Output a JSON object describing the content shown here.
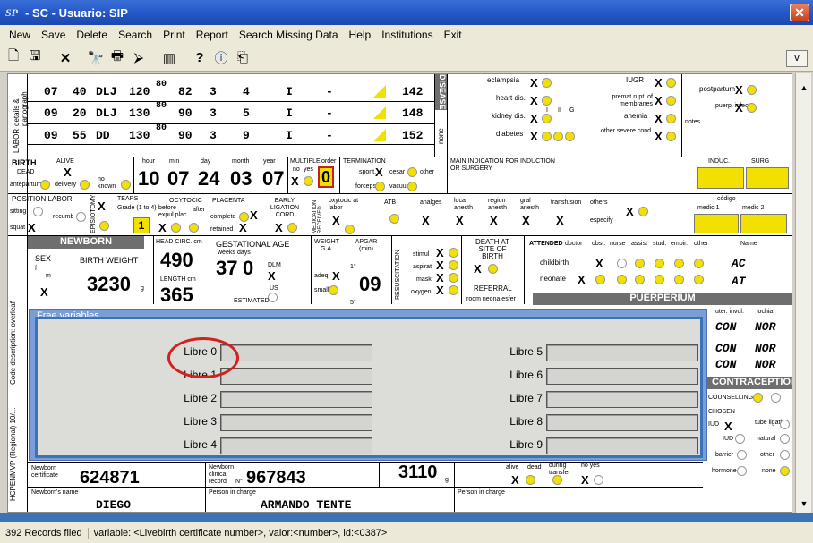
{
  "window": {
    "icon": "SP",
    "title": "- SC - Usuario: SIP",
    "close": "✕"
  },
  "menu": [
    "New",
    "Save",
    "Delete",
    "Search",
    "Print",
    "Report",
    "Search Missing Data",
    "Help",
    "Institutions",
    "Exit"
  ],
  "toolbar": {
    "v_label": "v"
  },
  "labor": {
    "side_labels": [
      "details & partograph",
      "LABOR"
    ],
    "rows": [
      [
        "07",
        "40",
        "DLJ",
        "120",
        "80",
        "82",
        "3",
        "4",
        "I",
        "-",
        "142"
      ],
      [
        "09",
        "20",
        "DLJ",
        "130",
        "80",
        "90",
        "3",
        "5",
        "I",
        "-",
        "148"
      ],
      [
        "09",
        "55",
        "DD",
        "130",
        "80",
        "90",
        "3",
        "9",
        "I",
        "-",
        "152"
      ]
    ]
  },
  "diseases": {
    "header": "DISEASES",
    "none": "none",
    "items_left": [
      "eclampsia",
      "heart dis.",
      "kidney dis.",
      "diabetes"
    ],
    "items_right": [
      "IUGR",
      "premat rupt. of membranes",
      "anemia",
      "other severe cond."
    ],
    "items_far": [
      "postpartum",
      "puerp. infect",
      "notes"
    ],
    "diabetes_types": [
      "I",
      "II",
      "G"
    ]
  },
  "birth": {
    "title": "BIRTH",
    "alive": "ALIVE",
    "dead": "DEAD",
    "antepartum": "antepartum",
    "delivery": "delivery",
    "no_known": "no known",
    "hour_label": "hour",
    "min_label": "min",
    "day_label": "day",
    "month_label": "month",
    "year_label": "year",
    "hour": "10",
    "min": "07",
    "day": "24",
    "month": "03",
    "year": "07",
    "multiple": "MULTIPLE",
    "order": "order",
    "order_value": "0",
    "no": "no",
    "yes": "yes",
    "termination": "TERMINATION",
    "spont": "spont.",
    "cesar": "cesar",
    "forceps": "forceps",
    "vacuum": "vacuum",
    "other": "other",
    "main_indication": "MAIN INDICATION FOR INDUCTION OR SURGERY",
    "induc": "INDUC.",
    "surg": "SURG",
    "code": "code"
  },
  "position": {
    "title": "POSITION LABOR",
    "sitting": "sitting",
    "recumb": "recumb",
    "squat": "squat",
    "episiotomy": "EPISIOTOMY",
    "tears": "TEARS",
    "grade": "Grade (1 to 4)",
    "tears_value": "1",
    "oxytocic": "OCYTOCIC",
    "before_expul": "before expul plac",
    "after": "after",
    "placenta": "PLACENTA",
    "complete": "complete",
    "retained": "retained",
    "early_ligation": "EARLY LIGATION CORD",
    "medication": "MEDICATION RECEIVED",
    "oxytocic_labor": "oxytocic at labor",
    "atb": "ATB",
    "analges": "analges",
    "local_anesth": "local anesth",
    "region_anesth": "region anesth",
    "gral_anesth": "gral anesth",
    "transfusion": "transfusion",
    "others": "others",
    "especify": "especify",
    "codigo": "código",
    "medic1": "medic 1",
    "medic2": "medic 2"
  },
  "newborn": {
    "title": "NEWBORN",
    "sex": "SEX",
    "f": "f",
    "m": "m",
    "birth_weight": "BIRTH WEIGHT",
    "weight": "3230",
    "g": "g",
    "head_circ": "HEAD CIRC. cm",
    "head_circ_value": "490",
    "length": "LENGTH cm",
    "length_value": "365",
    "gest_age": "GESTATIONAL AGE",
    "weeks": "weeks",
    "days": "days",
    "weeks_value": "37",
    "days_value": "0",
    "dlm": "DLM",
    "us": "US",
    "estimated": "ESTIMATED",
    "weight_ga": "WEIGHT G.A.",
    "adeq": "adeq.",
    "small": "small",
    "apgar": "APGAR (min)",
    "apgar_1": "1°",
    "apgar_5": "5°",
    "apgar_value": "09",
    "resuscitation": "RESUSCITATION",
    "stimul": "stimul",
    "aspirat": "aspirat",
    "mask": "mask",
    "oxygen": "oxygen",
    "death_site": "DEATH AT SITE OF BIRTH",
    "referral": "REFERRAL",
    "referral_sub": "room neona esfer"
  },
  "attended": {
    "title": "ATTENDED",
    "cols": [
      "doctor",
      "obst.",
      "nurse",
      "assist",
      "stud.",
      "empir.",
      "other"
    ],
    "name": "Name",
    "childbirth": "childbirth",
    "neonate": "neonate",
    "name1": "AC",
    "name2": "AT"
  },
  "puerperium": {
    "title": "PUERPERIUM",
    "cols": [
      "uter. invol.",
      "lochia"
    ],
    "rows": [
      [
        "CON",
        "NOR"
      ],
      [
        "CON",
        "NOR"
      ],
      [
        "CON",
        "NOR"
      ]
    ]
  },
  "contraception": {
    "title": "CONTRACEPTION",
    "counseling": "COUNSELLING",
    "chosen": "CHOSEN",
    "iud": "IUD",
    "tube_ligation": "tube ligation",
    "natural": "natural",
    "barrier": "barrier",
    "other": "other",
    "hormone": "hormone",
    "none": "none"
  },
  "bottom": {
    "newborn_cert": "Newborn certificate",
    "cert_value": "624871",
    "clinical_record": "Newborn clinical record",
    "record_value": "967843",
    "no": "N°",
    "weight_value": "3110",
    "g": "g",
    "alive": "alive",
    "dead": "dead",
    "during_transfer": "during transfer",
    "no_yes": "no yes",
    "newborn_name": "Newborn's name",
    "name_value": "DIEGO",
    "person_in_charge": "Person in charge",
    "person_value": "ARMANDO TENTE"
  },
  "left_vertical": {
    "a": "Code description: overleaf",
    "b": "HCPENMVP (Regional) 10/..."
  },
  "free_variables": {
    "title": "Free variables",
    "left": [
      "Libre 0",
      "Libre 1",
      "Libre 2",
      "Libre 3",
      "Libre 4"
    ],
    "right": [
      "Libre 5",
      "Libre 6",
      "Libre 7",
      "Libre 8",
      "Libre 9"
    ]
  },
  "status": {
    "records": "392 Records filed",
    "variable": "variable: <Livebirth certificate number>, valor:<number>, id:<0387>"
  },
  "colors": {
    "title_bar": "#2254c4",
    "highlight_yellow": "#f2e100",
    "dialog_border": "#3c73b8",
    "annotation_red": "#d42020"
  }
}
